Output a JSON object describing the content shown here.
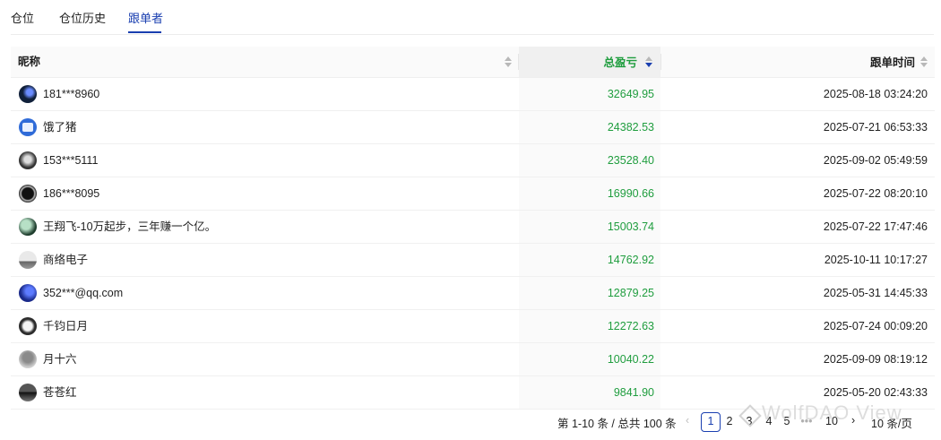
{
  "tabs": [
    "仓位",
    "仓位历史",
    "跟单者"
  ],
  "active_tab": "跟单者",
  "columns": {
    "nickname": "昵称",
    "pnl": "总盈亏",
    "follow_time": "跟单时间"
  },
  "rows": [
    {
      "nickname": "181***8960",
      "pnl": "32649.95",
      "follow_time": "2025-08-18 03:24:20"
    },
    {
      "nickname": "饿了猪",
      "pnl": "24382.53",
      "follow_time": "2025-07-21 06:53:33"
    },
    {
      "nickname": "153***5111",
      "pnl": "23528.40",
      "follow_time": "2025-09-02 05:49:59"
    },
    {
      "nickname": "186***8095",
      "pnl": "16990.66",
      "follow_time": "2025-07-22 08:20:10"
    },
    {
      "nickname": "王翔飞-10万起步，三年赚一个亿。",
      "pnl": "15003.74",
      "follow_time": "2025-07-22 17:47:46"
    },
    {
      "nickname": "商络电子",
      "pnl": "14762.92",
      "follow_time": "2025-10-11 10:17:27"
    },
    {
      "nickname": "352***@qq.com",
      "pnl": "12879.25",
      "follow_time": "2025-05-31 14:45:33"
    },
    {
      "nickname": "千钧日月",
      "pnl": "12272.63",
      "follow_time": "2025-07-24 00:09:20"
    },
    {
      "nickname": "月十六",
      "pnl": "10040.22",
      "follow_time": "2025-09-09 08:19:12"
    },
    {
      "nickname": "苍苍红",
      "pnl": "9841.90",
      "follow_time": "2025-05-20 02:43:33"
    }
  ],
  "pagination": {
    "total_text": "第 1-10 条 / 总共 100 条",
    "prev": "‹",
    "pages": [
      "1",
      "2",
      "3",
      "4",
      "5"
    ],
    "current_page": "1",
    "ellipsis": "•••",
    "last_page": "10",
    "next": "›",
    "page_size": "10 条/页"
  },
  "watermark": "WolfDAO View",
  "colors": {
    "accent": "#1a3fb0",
    "profit": "#1f9d3e"
  }
}
